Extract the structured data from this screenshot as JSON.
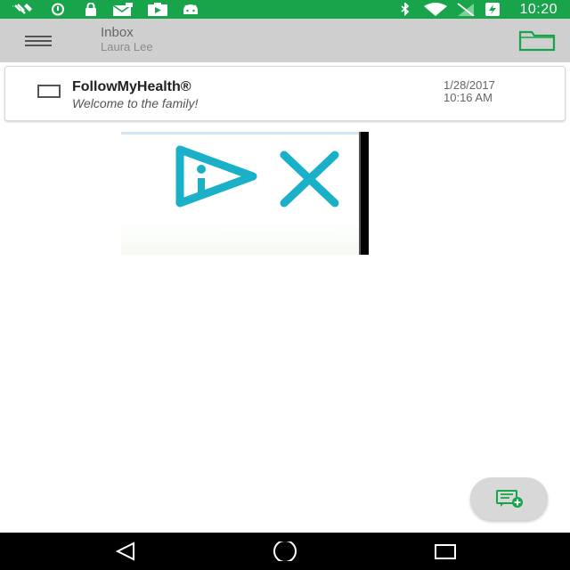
{
  "status_bar": {
    "time": "10:20",
    "left_icons": [
      "no-satellite-icon",
      "alarm-icon",
      "lock-icon",
      "mail-icon",
      "video-icon",
      "android-icon"
    ],
    "right_icons": [
      "bluetooth-icon",
      "wifi-icon",
      "no-sim-icon",
      "battery-charging-icon"
    ],
    "background": "#18a44a"
  },
  "app_bar": {
    "title": "Inbox",
    "subtitle": "Laura Lee",
    "menu_icon": "hamburger-menu-icon",
    "folder_icon": "folder-icon",
    "accent": "#18a44a"
  },
  "inbox": {
    "messages": [
      {
        "sender": "FollowMyHealth®",
        "subject": "Welcome to the family!",
        "date": "1/28/2017",
        "time": "10:16 AM",
        "checked": false
      }
    ]
  },
  "logo_image": {
    "icon": "followmyhealth-logo-icon",
    "accent": "#1ab0c8"
  },
  "fab": {
    "icon": "compose-message-icon"
  },
  "nav_bar": {
    "back_icon": "back-icon",
    "home_icon": "home-icon",
    "recents_icon": "recents-icon"
  }
}
